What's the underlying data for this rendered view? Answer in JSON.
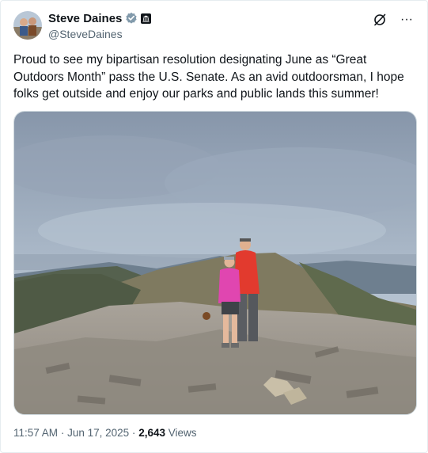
{
  "author": {
    "display_name": "Steve Daines",
    "handle": "@SteveDaines",
    "avatar_icon": "avatar",
    "verified_icon": "verified-badge-icon",
    "affiliation_icon": "government-badge-icon"
  },
  "actions": {
    "grok_icon": "grok-icon",
    "more_icon": "more-options-icon",
    "more_label": "···"
  },
  "tweet": {
    "text": "Proud to see my bipartisan resolution designating June as “Great Outdoors Month” pass the U.S. Senate. As an avid outdoorsman, I hope folks get outside and enjoy our parks and public lands this summer!"
  },
  "media": {
    "type": "photo"
  },
  "meta": {
    "time": "11:57 AM",
    "separator": "·",
    "date": "Jun 17, 2025",
    "views_count": "2,643",
    "views_label": "Views"
  },
  "colors": {
    "text": "#0f1419",
    "secondary": "#536471",
    "verified": "#829aab",
    "border": "#e6ecf0"
  }
}
